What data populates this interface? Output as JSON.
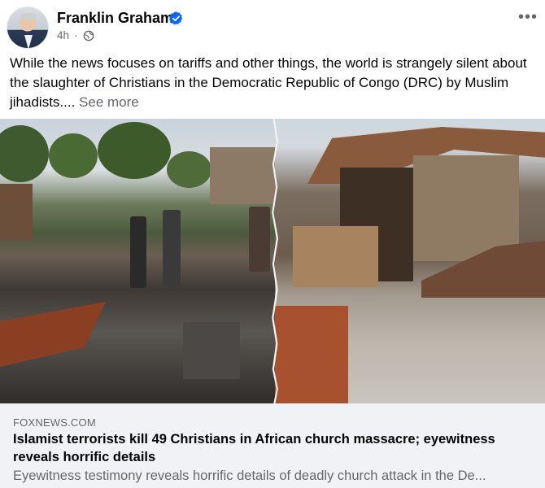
{
  "post": {
    "author": "Franklin Graham",
    "time": "4h",
    "dot": "·",
    "text": "While the news focuses on tariffs and other things, the world is strangely silent about the slaughter of Christians in the Democratic Republic of Congo (DRC) by Muslim jihadists....",
    "see_more": "See more",
    "more_menu": "•••",
    "icons": {
      "verified": "verified-badge-icon",
      "privacy": "globe-icon",
      "menu": "more-options-icon"
    }
  },
  "link_preview": {
    "source": "FOXNEWS.COM",
    "headline": "Islamist terrorists kill 49 Christians in African church massacre; eyewitness reveals horrific details",
    "description": "Eyewitness testimony reveals horrific details of deadly church attack in the De..."
  },
  "colors": {
    "verified_blue": "#0866ff",
    "secondary_text": "#65676b",
    "card_background": "#f0f2f5"
  }
}
